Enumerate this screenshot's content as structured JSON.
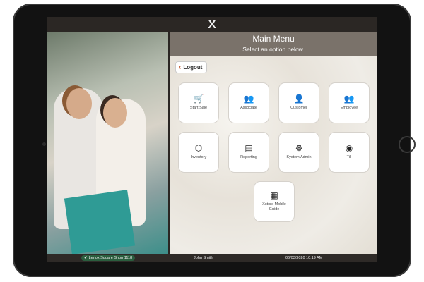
{
  "topbar": {
    "logo": "X"
  },
  "header": {
    "title": "Main Menu",
    "subtitle": "Select an option below."
  },
  "logout_label": "Logout",
  "tiles": [
    {
      "label": "Start Sale",
      "icon": "🛒"
    },
    {
      "label": "Associate",
      "icon": "👥"
    },
    {
      "label": "Customer",
      "icon": "👤"
    },
    {
      "label": "Employee",
      "icon": "👥"
    },
    {
      "label": "Inventory",
      "icon": "⬡"
    },
    {
      "label": "Reporting",
      "icon": "▤"
    },
    {
      "label": "System Admin",
      "icon": "⚙"
    },
    {
      "label": "Till",
      "icon": "◉"
    },
    {
      "label": "Xstore Mobile Guide",
      "icon": "▦"
    }
  ],
  "status": {
    "store": "Lenox Square Shop 1118",
    "store_icon": "✔",
    "user": "John Smith",
    "datetime": "06/03/2020 10:19 AM"
  }
}
